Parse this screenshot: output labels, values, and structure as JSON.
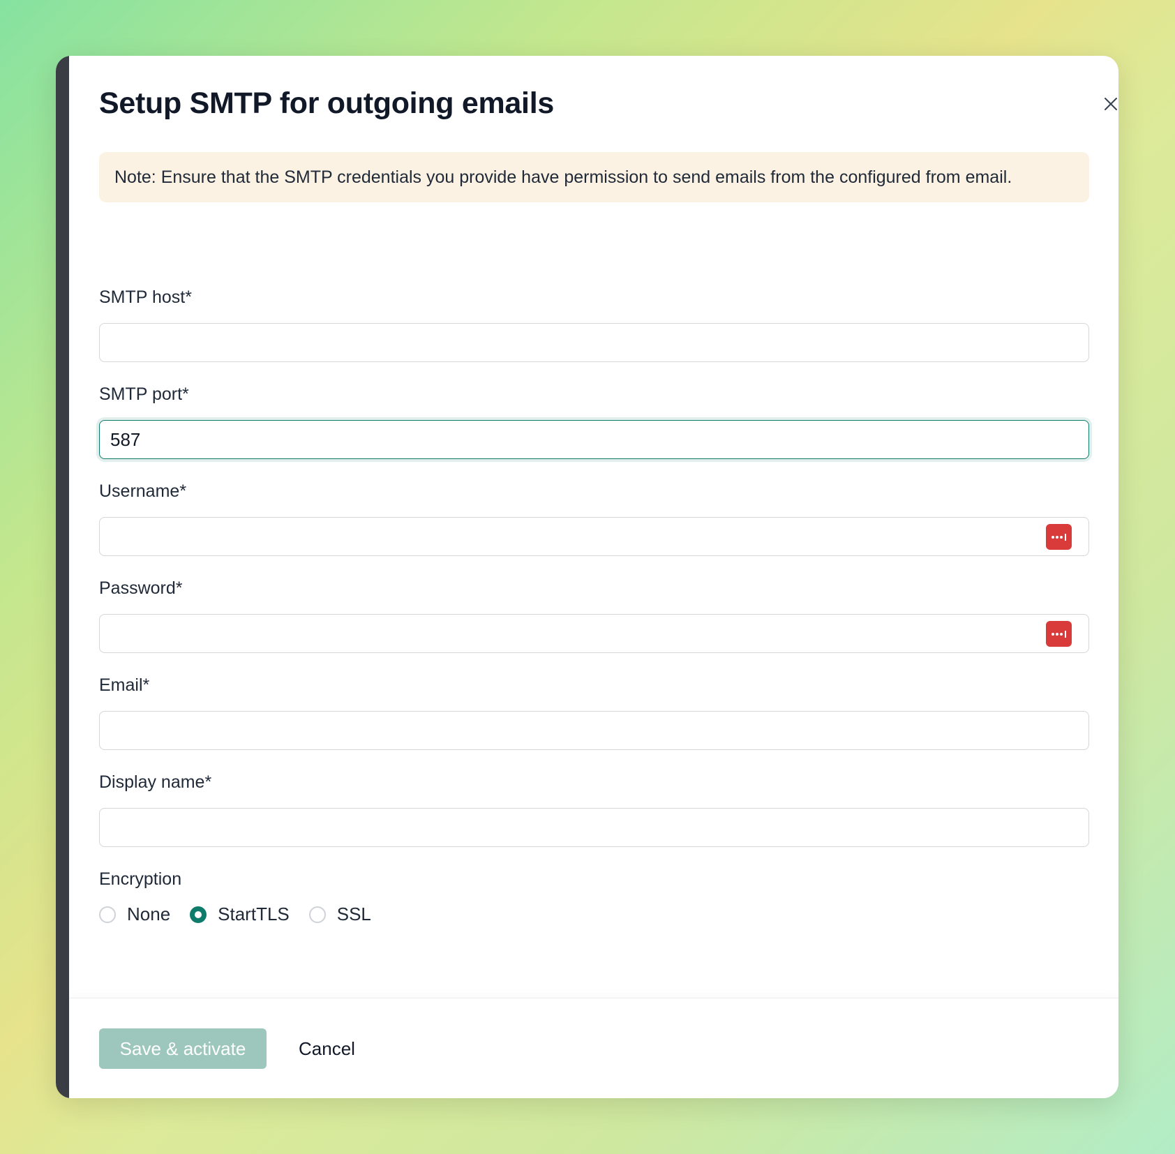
{
  "dialog": {
    "title": "Setup SMTP for outgoing emails",
    "close_icon": "close-icon",
    "note": "Note: Ensure that the SMTP credentials you provide have permission to send emails from the configured from email."
  },
  "fields": {
    "smtp_host": {
      "label": "SMTP host*",
      "value": ""
    },
    "smtp_port": {
      "label": "SMTP port*",
      "value": "587"
    },
    "username": {
      "label": "Username*",
      "value": "",
      "autofill_icon": "password-manager-icon"
    },
    "password": {
      "label": "Password*",
      "value": "",
      "autofill_icon": "password-manager-icon"
    },
    "email": {
      "label": "Email*",
      "value": ""
    },
    "display_name": {
      "label": "Display name*",
      "value": ""
    }
  },
  "encryption": {
    "label": "Encryption",
    "options": [
      "None",
      "StartTLS",
      "SSL"
    ],
    "selected": "StartTLS"
  },
  "footer": {
    "save_label": "Save & activate",
    "cancel_label": "Cancel"
  },
  "colors": {
    "accent": "#0f7c6b",
    "save_disabled": "#9dc7bd",
    "note_bg": "#fcf2e3",
    "autofill_badge": "#d93a3a"
  }
}
